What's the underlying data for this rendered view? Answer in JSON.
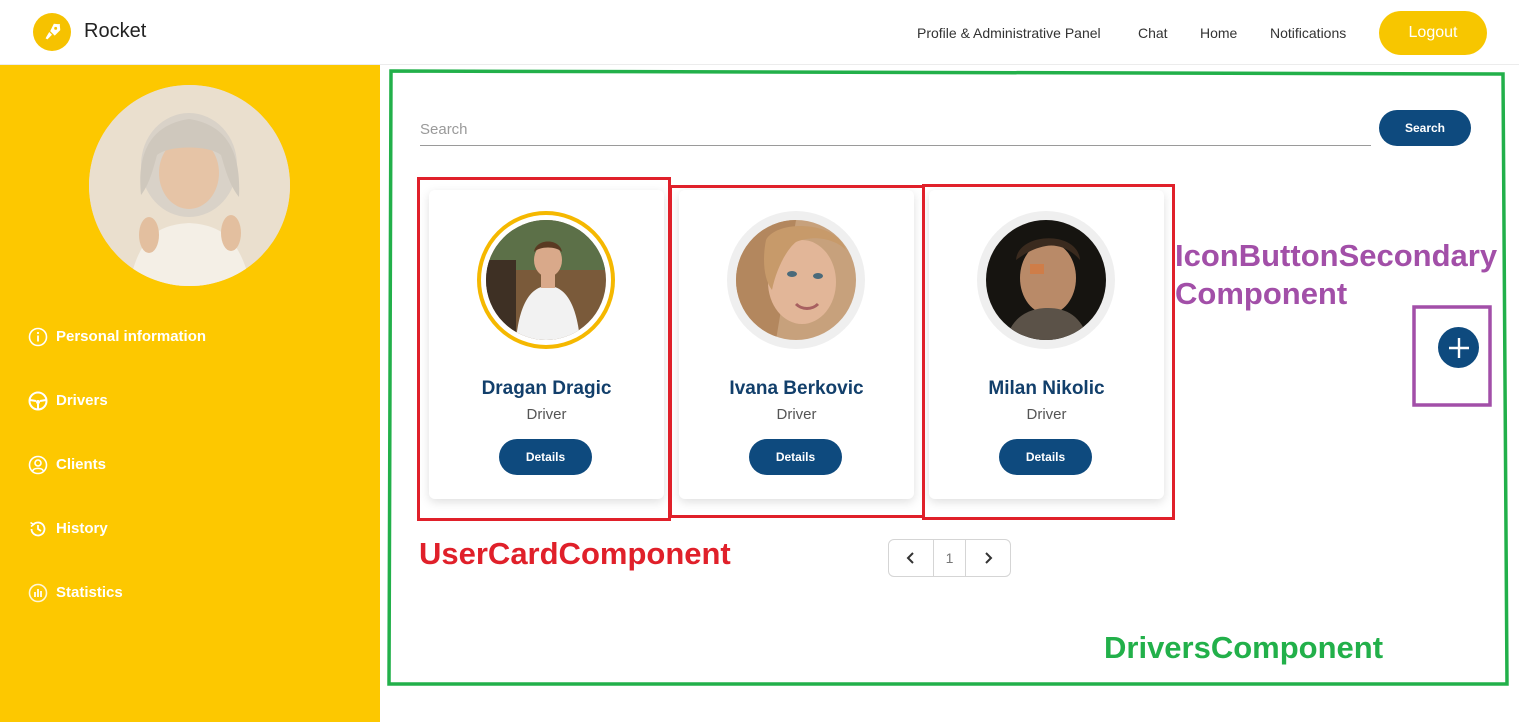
{
  "header": {
    "brand": "Rocket",
    "nav": [
      "Profile & Administrative Panel",
      "Chat",
      "Home",
      "Notifications"
    ],
    "logout_label": "Logout",
    "accent_color": "#f7c600"
  },
  "sidebar": {
    "items": [
      {
        "label": "Personal information",
        "icon": "info-circle-icon"
      },
      {
        "label": "Drivers",
        "icon": "steering-wheel-icon"
      },
      {
        "label": "Clients",
        "icon": "user-circle-icon"
      },
      {
        "label": "History",
        "icon": "history-icon"
      },
      {
        "label": "Statistics",
        "icon": "chart-circle-icon"
      }
    ],
    "background_color": "#fdc800"
  },
  "main": {
    "search": {
      "placeholder": "Search",
      "button_label": "Search"
    },
    "cards": [
      {
        "name": "Dragan Dragic",
        "role": "Driver",
        "button_label": "Details",
        "selected": true
      },
      {
        "name": "Ivana Berkovic",
        "role": "Driver",
        "button_label": "Details",
        "selected": false
      },
      {
        "name": "Milan Nikolic",
        "role": "Driver",
        "button_label": "Details",
        "selected": false
      }
    ],
    "pagination": {
      "current_page": "1"
    },
    "primary_color": "#0e4a7e"
  },
  "annotations": {
    "user_card": "UserCardComponent",
    "icon_button": "IconButtonSecondary Component",
    "icon_button_line1": "IconButtonSecondary",
    "icon_button_line2": "Component",
    "drivers": "DriversComponent"
  }
}
